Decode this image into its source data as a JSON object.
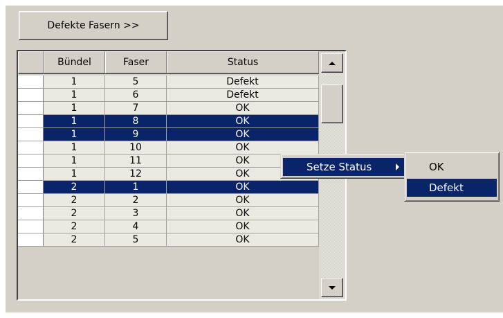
{
  "toolbar": {
    "defekte_button_label": "Defekte Fasern >>"
  },
  "table": {
    "columns": [
      "",
      "Bündel",
      "Faser",
      "Status"
    ],
    "rows": [
      {
        "buendel": "1",
        "faser": "5",
        "status": "Defekt",
        "selected": false
      },
      {
        "buendel": "1",
        "faser": "6",
        "status": "Defekt",
        "selected": false
      },
      {
        "buendel": "1",
        "faser": "7",
        "status": "OK",
        "selected": false
      },
      {
        "buendel": "1",
        "faser": "8",
        "status": "OK",
        "selected": true
      },
      {
        "buendel": "1",
        "faser": "9",
        "status": "OK",
        "selected": true
      },
      {
        "buendel": "1",
        "faser": "10",
        "status": "OK",
        "selected": false
      },
      {
        "buendel": "1",
        "faser": "11",
        "status": "OK",
        "selected": false
      },
      {
        "buendel": "1",
        "faser": "12",
        "status": "OK",
        "selected": false
      },
      {
        "buendel": "2",
        "faser": "1",
        "status": "OK",
        "selected": true
      },
      {
        "buendel": "2",
        "faser": "2",
        "status": "OK",
        "selected": false
      },
      {
        "buendel": "2",
        "faser": "3",
        "status": "OK",
        "selected": false
      },
      {
        "buendel": "2",
        "faser": "4",
        "status": "OK",
        "selected": false
      },
      {
        "buendel": "2",
        "faser": "5",
        "status": "OK",
        "selected": false
      }
    ]
  },
  "context_menu": {
    "item_label": "Setze Status",
    "submenu": [
      {
        "label": "OK",
        "highlighted": false
      },
      {
        "label": "Defekt",
        "highlighted": true
      }
    ]
  },
  "colors": {
    "panel_bg": "#d4d0c8",
    "selection": "#0a246a",
    "cell_bg": "#ece9e2"
  },
  "icons": [
    "scroll-up-arrow-icon",
    "scroll-down-arrow-icon",
    "submenu-arrow-icon"
  ]
}
